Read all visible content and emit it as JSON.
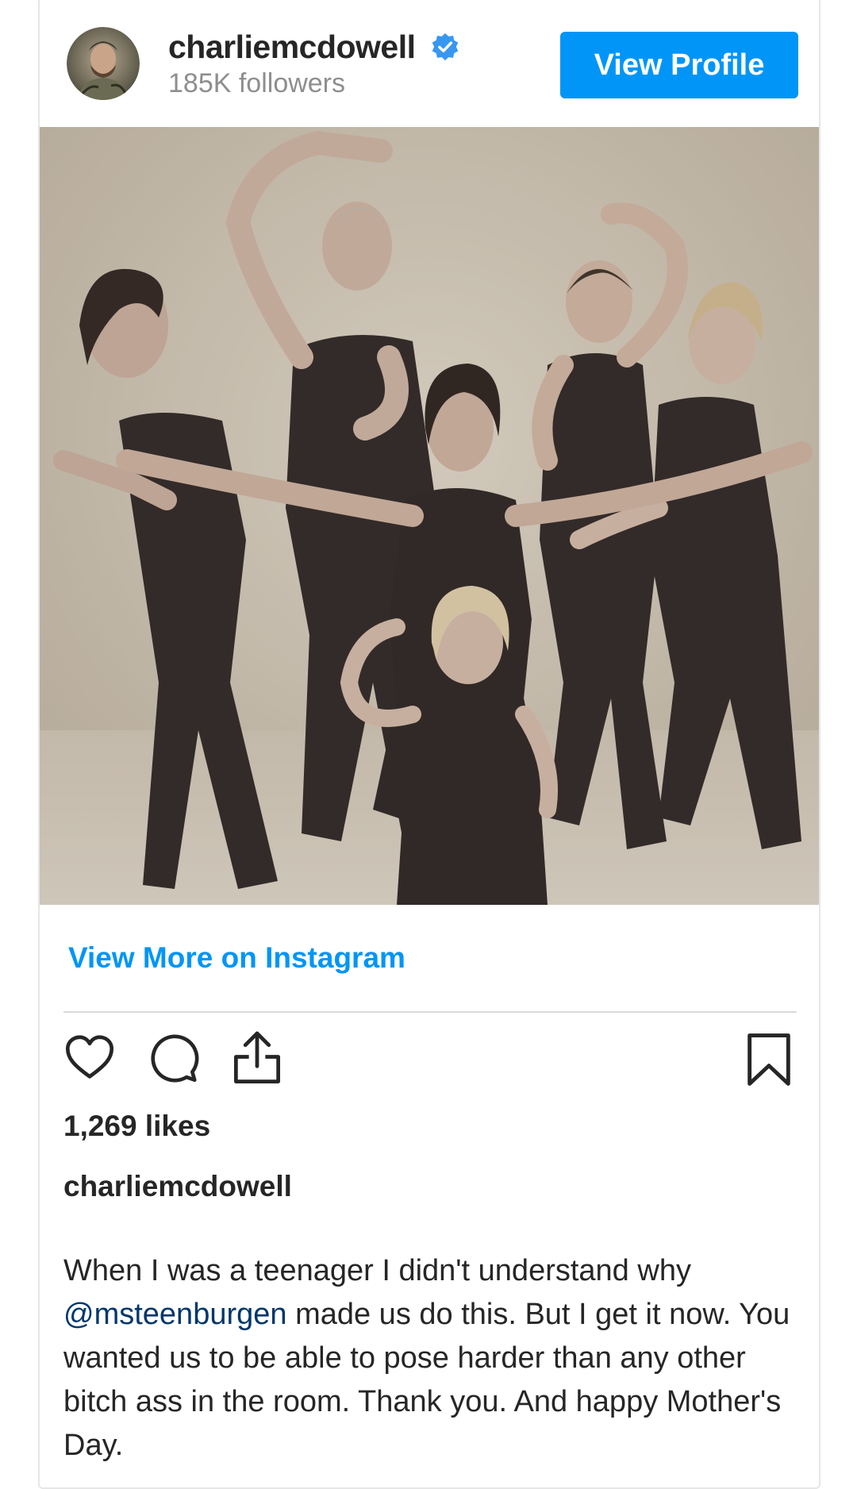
{
  "header": {
    "username": "charliemcdowell",
    "followers": "185K followers",
    "view_profile_label": "View Profile",
    "avatar_icon": "avatar",
    "verified_icon": "verified-badge-icon"
  },
  "colors": {
    "accent": "#0095f6",
    "mention": "#00376b",
    "muted": "#8e8e8e",
    "text": "#262626"
  },
  "post": {
    "image_alt": "sepia group photo",
    "view_more_label": "View More on Instagram",
    "actions": {
      "like_icon": "heart-icon",
      "comment_icon": "comment-icon",
      "share_icon": "share-icon",
      "save_icon": "bookmark-icon"
    },
    "likes": "1,269 likes",
    "caption_user": "charliemcdowell",
    "caption_before": "When I was a teenager I didn't understand why ",
    "caption_mention": "@msteenburgen",
    "caption_after": " made us do this. But I get it now. You wanted us to be able to pose harder than any other bitch ass in the room. Thank you. And happy Mother's Day."
  }
}
